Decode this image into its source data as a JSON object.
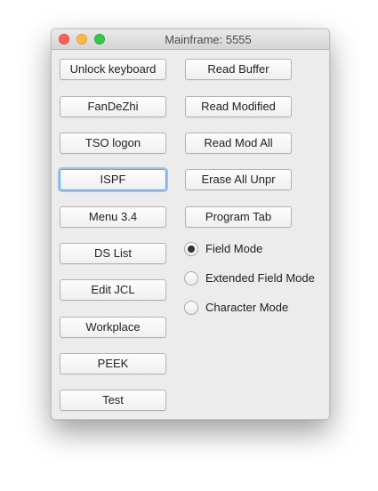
{
  "window": {
    "title": "Mainframe: 5555"
  },
  "left_buttons": [
    {
      "label": "Unlock keyboard"
    },
    {
      "label": "FanDeZhi"
    },
    {
      "label": "TSO logon"
    },
    {
      "label": "ISPF"
    },
    {
      "label": "Menu 3.4"
    },
    {
      "label": "DS List"
    },
    {
      "label": "Edit JCL"
    },
    {
      "label": "Workplace"
    },
    {
      "label": "PEEK"
    },
    {
      "label": "Test"
    }
  ],
  "right_buttons": [
    {
      "label": "Read Buffer"
    },
    {
      "label": "Read Modified"
    },
    {
      "label": "Read Mod All"
    },
    {
      "label": "Erase All Unpr"
    },
    {
      "label": "Program Tab"
    }
  ],
  "modes": [
    {
      "label": "Field Mode",
      "selected": true
    },
    {
      "label": "Extended Field Mode",
      "selected": false
    },
    {
      "label": "Character Mode",
      "selected": false
    }
  ],
  "colors": {
    "focus_ring": "#5fa2e8",
    "close": "#fc605c",
    "minimize": "#fdbc40",
    "zoom": "#34c84a"
  }
}
